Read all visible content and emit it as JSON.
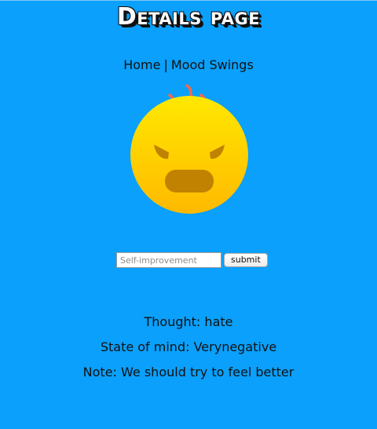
{
  "page": {
    "title": "Details page"
  },
  "nav": {
    "home_label": "Home",
    "separator": "|",
    "mood_swings_label": "Mood Swings"
  },
  "emoji": {
    "icon": "angry-face-icon",
    "colors": {
      "face_top": "#ffe600",
      "face_bottom": "#ffb800",
      "features": "#c08200",
      "steam": "#f06b4c"
    }
  },
  "form": {
    "input_value": "",
    "input_placeholder": "Self-improvement",
    "submit_label": "submit"
  },
  "details": {
    "thought_label": "Thought:",
    "thought_value": "hate",
    "state_label": "State of mind:",
    "state_value": "Verynegative",
    "note_label": "Note:",
    "note_value": "We should try to feel better"
  },
  "colors": {
    "background": "#0aa0fb",
    "text": "#111111"
  }
}
